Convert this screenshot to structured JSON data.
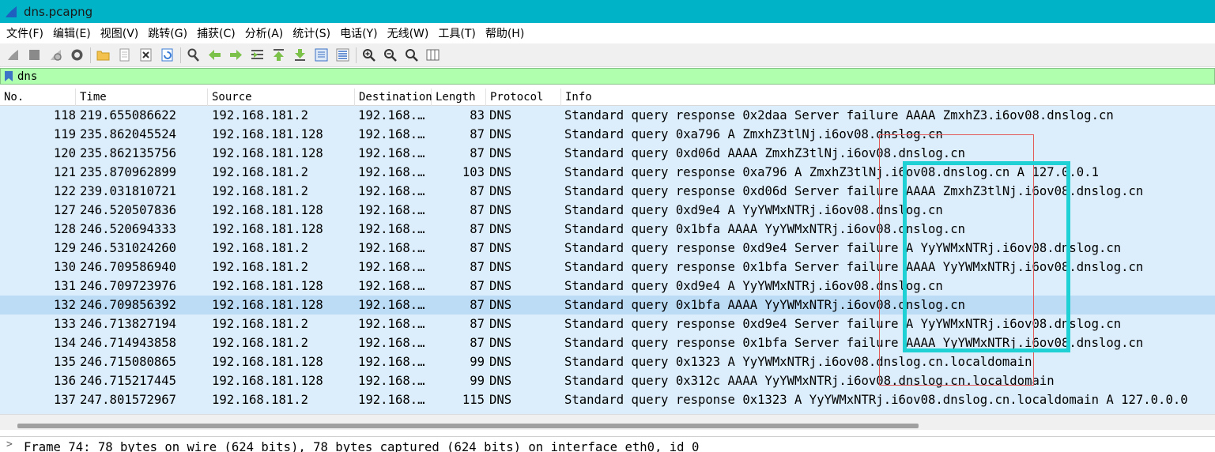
{
  "window": {
    "title": "dns.pcapng"
  },
  "menu": [
    "文件(F)",
    "编辑(E)",
    "视图(V)",
    "跳转(G)",
    "捕获(C)",
    "分析(A)",
    "统计(S)",
    "电话(Y)",
    "无线(W)",
    "工具(T)",
    "帮助(H)"
  ],
  "filter": {
    "value": "dns"
  },
  "columns": {
    "no": "No.",
    "time": "Time",
    "source": "Source",
    "destination": "Destination",
    "length": "Length",
    "protocol": "Protocol",
    "info": "Info"
  },
  "packets": [
    {
      "no": "118",
      "time": "219.655086622",
      "source": "192.168.181.2",
      "destination": "192.168.…",
      "length": "83",
      "protocol": "DNS",
      "info": "Standard query response 0x2daa Server failure AAAA ZmxhZ3.i6ov08.dnslog.cn"
    },
    {
      "no": "119",
      "time": "235.862045524",
      "source": "192.168.181.128",
      "destination": "192.168.…",
      "length": "87",
      "protocol": "DNS",
      "info": "Standard query 0xa796 A ZmxhZ3tlNj.i6ov08.dnslog.cn"
    },
    {
      "no": "120",
      "time": "235.862135756",
      "source": "192.168.181.128",
      "destination": "192.168.…",
      "length": "87",
      "protocol": "DNS",
      "info": "Standard query 0xd06d AAAA ZmxhZ3tlNj.i6ov08.dnslog.cn"
    },
    {
      "no": "121",
      "time": "235.870962899",
      "source": "192.168.181.2",
      "destination": "192.168.…",
      "length": "103",
      "protocol": "DNS",
      "info": "Standard query response 0xa796 A ZmxhZ3tlNj.i6ov08.dnslog.cn A 127.0.0.1"
    },
    {
      "no": "122",
      "time": "239.031810721",
      "source": "192.168.181.2",
      "destination": "192.168.…",
      "length": "87",
      "protocol": "DNS",
      "info": "Standard query response 0xd06d Server failure AAAA ZmxhZ3tlNj.i6ov08.dnslog.cn"
    },
    {
      "no": "127",
      "time": "246.520507836",
      "source": "192.168.181.128",
      "destination": "192.168.…",
      "length": "87",
      "protocol": "DNS",
      "info": "Standard query 0xd9e4 A YyYWMxNTRj.i6ov08.dnslog.cn"
    },
    {
      "no": "128",
      "time": "246.520694333",
      "source": "192.168.181.128",
      "destination": "192.168.…",
      "length": "87",
      "protocol": "DNS",
      "info": "Standard query 0x1bfa AAAA YyYWMxNTRj.i6ov08.dnslog.cn"
    },
    {
      "no": "129",
      "time": "246.531024260",
      "source": "192.168.181.2",
      "destination": "192.168.…",
      "length": "87",
      "protocol": "DNS",
      "info": "Standard query response 0xd9e4 Server failure A YyYWMxNTRj.i6ov08.dnslog.cn"
    },
    {
      "no": "130",
      "time": "246.709586940",
      "source": "192.168.181.2",
      "destination": "192.168.…",
      "length": "87",
      "protocol": "DNS",
      "info": "Standard query response 0x1bfa Server failure AAAA YyYWMxNTRj.i6ov08.dnslog.cn"
    },
    {
      "no": "131",
      "time": "246.709723976",
      "source": "192.168.181.128",
      "destination": "192.168.…",
      "length": "87",
      "protocol": "DNS",
      "info": "Standard query 0xd9e4 A YyYWMxNTRj.i6ov08.dnslog.cn"
    },
    {
      "no": "132",
      "time": "246.709856392",
      "source": "192.168.181.128",
      "destination": "192.168.…",
      "length": "87",
      "protocol": "DNS",
      "info": "Standard query 0x1bfa AAAA YyYWMxNTRj.i6ov08.dnslog.cn",
      "selected": true
    },
    {
      "no": "133",
      "time": "246.713827194",
      "source": "192.168.181.2",
      "destination": "192.168.…",
      "length": "87",
      "protocol": "DNS",
      "info": "Standard query response 0xd9e4 Server failure A YyYWMxNTRj.i6ov08.dnslog.cn"
    },
    {
      "no": "134",
      "time": "246.714943858",
      "source": "192.168.181.2",
      "destination": "192.168.…",
      "length": "87",
      "protocol": "DNS",
      "info": "Standard query response 0x1bfa Server failure AAAA YyYWMxNTRj.i6ov08.dnslog.cn"
    },
    {
      "no": "135",
      "time": "246.715080865",
      "source": "192.168.181.128",
      "destination": "192.168.…",
      "length": "99",
      "protocol": "DNS",
      "info": "Standard query 0x1323 A YyYWMxNTRj.i6ov08.dnslog.cn.localdomain"
    },
    {
      "no": "136",
      "time": "246.715217445",
      "source": "192.168.181.128",
      "destination": "192.168.…",
      "length": "99",
      "protocol": "DNS",
      "info": "Standard query 0x312c AAAA YyYWMxNTRj.i6ov08.dnslog.cn.localdomain"
    },
    {
      "no": "137",
      "time": "247.801572967",
      "source": "192.168.181.2",
      "destination": "192.168.…",
      "length": "115",
      "protocol": "DNS",
      "info": "Standard query response 0x1323 A YyYWMxNTRj.i6ov08.dnslog.cn.localdomain A 127.0.0.0"
    }
  ],
  "details": {
    "frame": "Frame 74: 78 bytes on wire (624 bits), 78 bytes captured (624 bits) on interface eth0, id 0"
  },
  "colors": {
    "titlebar": "#00b3c7",
    "filter_bg": "#afffaf",
    "row_bg": "#dceefc",
    "row_selected": "#bcdcf6",
    "annotation_red": "#e25a5a",
    "annotation_cyan": "#1fd1d4"
  }
}
